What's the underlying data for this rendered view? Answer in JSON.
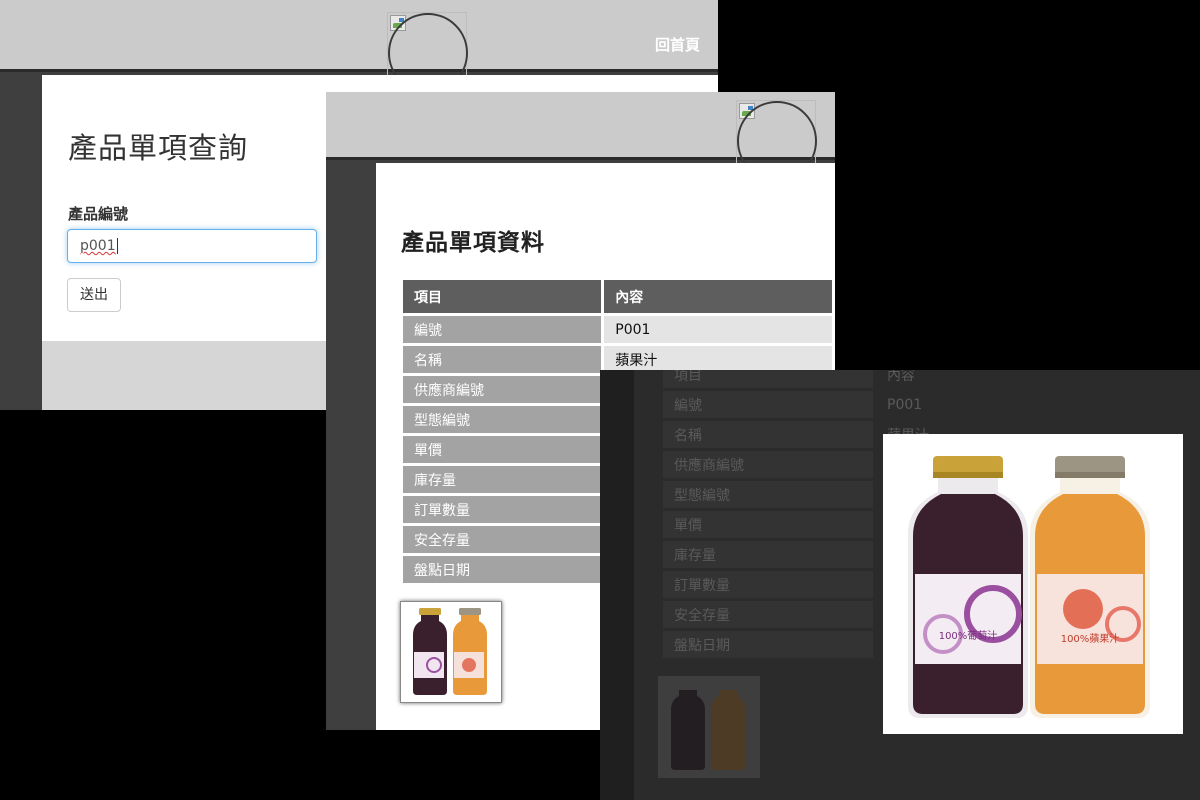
{
  "query_page": {
    "home_link": "回首頁",
    "title": "產品單項查詢",
    "field_label": "產品編號",
    "input_value": "p001",
    "submit_label": "送出"
  },
  "detail_page": {
    "title": "產品單項資料",
    "table": {
      "headers": [
        "項目",
        "內容"
      ],
      "rows": [
        {
          "key": "編號",
          "value": "P001"
        },
        {
          "key": "名稱",
          "value": "蘋果汁"
        },
        {
          "key": "供應商編號",
          "value": ""
        },
        {
          "key": "型態編號",
          "value": ""
        },
        {
          "key": "單價",
          "value": ""
        },
        {
          "key": "庫存量",
          "value": ""
        },
        {
          "key": "訂單數量",
          "value": ""
        },
        {
          "key": "安全存量",
          "value": ""
        },
        {
          "key": "盤點日期",
          "value": ""
        }
      ]
    }
  },
  "lightbox": {
    "visible_table_header_partial": [
      "項目",
      "內容"
    ],
    "rows": [
      {
        "key": "編號",
        "value": "P001"
      },
      {
        "key": "名稱",
        "value": "蘋果汁"
      },
      {
        "key": "供應商編號",
        "value": ""
      },
      {
        "key": "型態編號",
        "value": ""
      },
      {
        "key": "單價",
        "value": ""
      },
      {
        "key": "庫存量",
        "value": ""
      },
      {
        "key": "訂單數量",
        "value": ""
      },
      {
        "key": "安全存量",
        "value": ""
      },
      {
        "key": "盤點日期",
        "value": ""
      }
    ],
    "bottle_labels": [
      "100%葡萄汁",
      "100%蘋果汁"
    ]
  },
  "colors": {
    "header_bg": "#cbcbcb",
    "sidebar_bg": "#3f3f3f",
    "table_header_bg": "#5e5e5e",
    "table_key_bg": "#a3a3a3",
    "table_value_bg": "#e4e4e4",
    "input_focus": "#66afe9",
    "grape_juice": "#3a1f2c",
    "apple_juice": "#e89a3a"
  },
  "icons": [
    "broken-image-icon",
    "logo-circle-icon"
  ]
}
